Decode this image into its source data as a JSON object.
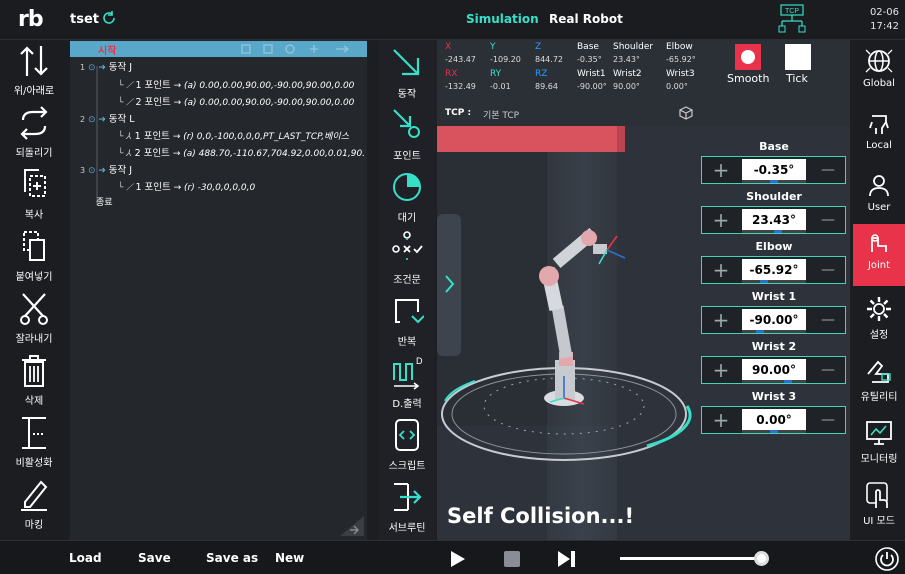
{
  "app": {
    "logo": "rb",
    "project": "tset",
    "date": "02-06",
    "time": "17:42"
  },
  "top_tabs": {
    "simulation": "Simulation",
    "real_robot": "Real Robot",
    "tcp_badge": "TCP"
  },
  "left_toolbar": [
    "위/아래로",
    "되돌리기",
    "복사",
    "붙여넣기",
    "잘라내기",
    "삭제",
    "비활성화",
    "마킹"
  ],
  "tree": {
    "start": "시작",
    "end": "종료",
    "rows": [
      {
        "num": "1",
        "cmd": "동작 J"
      },
      {
        "num": "",
        "sub": "1 포인트",
        "text": "→ (a) 0.00,0.00,90.00,-90.00,90.00,0.00"
      },
      {
        "num": "",
        "sub": "2 포인트",
        "text": "→ (a) 0.00,0.00,90.00,-90.00,90.00,0.00"
      },
      {
        "num": "2",
        "cmd": "동작 L"
      },
      {
        "num": "",
        "sub": "1 포인트",
        "text": "→ (r) 0,0,-100,0,0,0,PT_LAST_TCP,베이스"
      },
      {
        "num": "",
        "sub": "2 포인트",
        "text": "→ (a) 488.70,-110.67,704.92,0.00,0.01,90."
      },
      {
        "num": "3",
        "cmd": "동작 J"
      },
      {
        "num": "",
        "sub": "1 포인트",
        "text": "→ (r) -30,0,0,0,0,0"
      }
    ]
  },
  "mid_toolbar": [
    "동작",
    "포인트",
    "대기",
    "조건문",
    "반복",
    "D.출력",
    "스크립트",
    "서브루틴"
  ],
  "readout": {
    "headers1": [
      "X",
      "Y",
      "Z",
      "Base",
      "Shoulder",
      "Elbow"
    ],
    "values1": [
      "-243.47",
      "-109.20",
      "844.72",
      "-0.35°",
      "23.43°",
      "-65.92°"
    ],
    "headers2": [
      "RX",
      "RY",
      "RZ",
      "Wrist1",
      "Wrist2",
      "Wrist3"
    ],
    "values2": [
      "-132.49",
      "-0.01",
      "89.64",
      "-90.00°",
      "90.00°",
      "0.00°"
    ],
    "smooth": "Smooth",
    "tick": "Tick",
    "tcp_label": "TCP :",
    "tcp_value": "기본 TCP"
  },
  "joints": [
    {
      "name": "Base",
      "value": "-0.35°",
      "level": 0.5
    },
    {
      "name": "Shoulder",
      "value": "23.43°",
      "level": 0.57
    },
    {
      "name": "Elbow",
      "value": "-65.92°",
      "level": 0.32
    },
    {
      "name": "Wrist 1",
      "value": "-90.00°",
      "level": 0.25
    },
    {
      "name": "Wrist 2",
      "value": "90.00°",
      "level": 0.75
    },
    {
      "name": "Wrist 3",
      "value": "0.00°",
      "level": 0.5
    }
  ],
  "status_message": "Self Collision...!",
  "right_toolbar": [
    "Global",
    "Local",
    "User",
    "Joint",
    "설정",
    "유틸리티",
    "모니터링",
    "UI 모드"
  ],
  "bottom": {
    "load": "Load",
    "save": "Save",
    "save_as": "Save as",
    "new": "New",
    "speed_level": 1.0
  },
  "colors": {
    "accent": "#36e0c8",
    "active": "#e8334a",
    "highlight": "#5aa8c9"
  }
}
